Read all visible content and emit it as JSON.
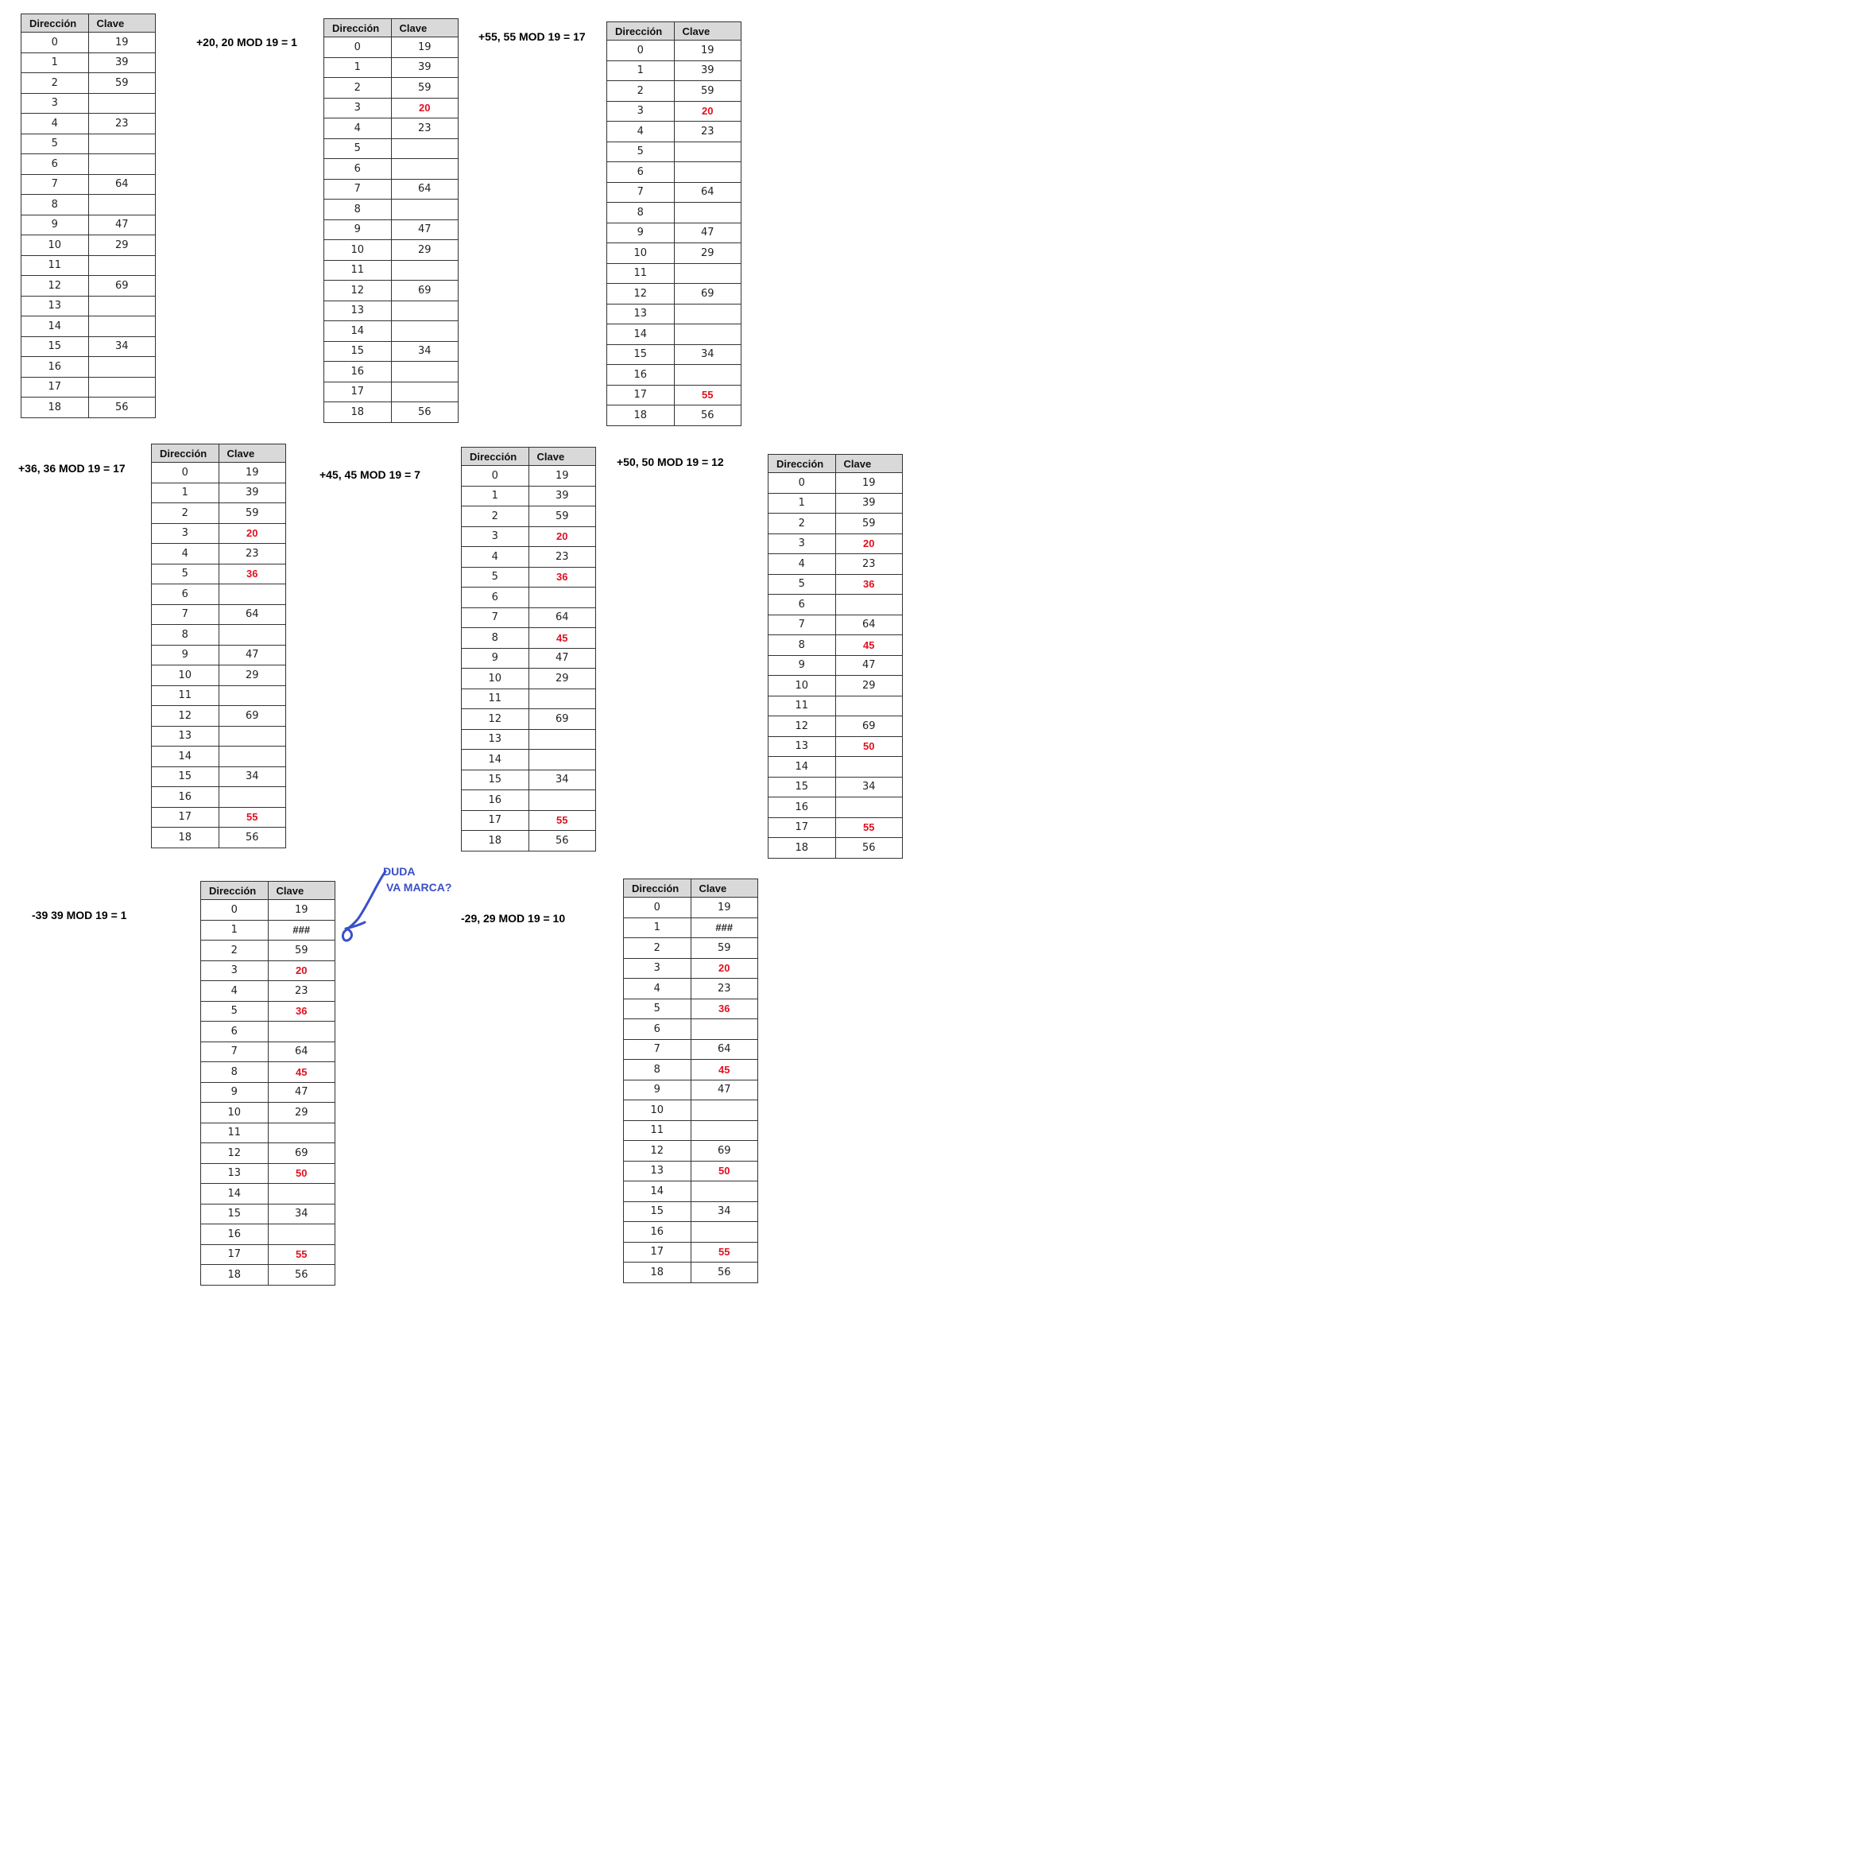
{
  "headers": {
    "address": "Dirección",
    "key": "Clave"
  },
  "steps": [
    {
      "op_label": "",
      "rows": [
        {
          "addr": "0",
          "key": "19"
        },
        {
          "addr": "1",
          "key": "39"
        },
        {
          "addr": "2",
          "key": "59"
        },
        {
          "addr": "3",
          "key": ""
        },
        {
          "addr": "4",
          "key": "23"
        },
        {
          "addr": "5",
          "key": ""
        },
        {
          "addr": "6",
          "key": ""
        },
        {
          "addr": "7",
          "key": "64"
        },
        {
          "addr": "8",
          "key": ""
        },
        {
          "addr": "9",
          "key": "47"
        },
        {
          "addr": "10",
          "key": "29"
        },
        {
          "addr": "11",
          "key": ""
        },
        {
          "addr": "12",
          "key": "69"
        },
        {
          "addr": "13",
          "key": ""
        },
        {
          "addr": "14",
          "key": ""
        },
        {
          "addr": "15",
          "key": "34"
        },
        {
          "addr": "16",
          "key": ""
        },
        {
          "addr": "17",
          "key": ""
        },
        {
          "addr": "18",
          "key": "56"
        }
      ]
    },
    {
      "op_label": "+20, 20 MOD 19 = 1",
      "rows": [
        {
          "addr": "0",
          "key": "19"
        },
        {
          "addr": "1",
          "key": "39"
        },
        {
          "addr": "2",
          "key": "59"
        },
        {
          "addr": "3",
          "key": "20",
          "new": true
        },
        {
          "addr": "4",
          "key": "23"
        },
        {
          "addr": "5",
          "key": ""
        },
        {
          "addr": "6",
          "key": ""
        },
        {
          "addr": "7",
          "key": "64"
        },
        {
          "addr": "8",
          "key": ""
        },
        {
          "addr": "9",
          "key": "47"
        },
        {
          "addr": "10",
          "key": "29"
        },
        {
          "addr": "11",
          "key": ""
        },
        {
          "addr": "12",
          "key": "69"
        },
        {
          "addr": "13",
          "key": ""
        },
        {
          "addr": "14",
          "key": ""
        },
        {
          "addr": "15",
          "key": "34"
        },
        {
          "addr": "16",
          "key": ""
        },
        {
          "addr": "17",
          "key": ""
        },
        {
          "addr": "18",
          "key": "56"
        }
      ]
    },
    {
      "op_label": "+55, 55 MOD 19 = 17",
      "rows": [
        {
          "addr": "0",
          "key": "19"
        },
        {
          "addr": "1",
          "key": "39"
        },
        {
          "addr": "2",
          "key": "59"
        },
        {
          "addr": "3",
          "key": "20",
          "new": true
        },
        {
          "addr": "4",
          "key": "23"
        },
        {
          "addr": "5",
          "key": ""
        },
        {
          "addr": "6",
          "key": ""
        },
        {
          "addr": "7",
          "key": "64"
        },
        {
          "addr": "8",
          "key": ""
        },
        {
          "addr": "9",
          "key": "47"
        },
        {
          "addr": "10",
          "key": "29"
        },
        {
          "addr": "11",
          "key": ""
        },
        {
          "addr": "12",
          "key": "69"
        },
        {
          "addr": "13",
          "key": ""
        },
        {
          "addr": "14",
          "key": ""
        },
        {
          "addr": "15",
          "key": "34"
        },
        {
          "addr": "16",
          "key": ""
        },
        {
          "addr": "17",
          "key": "55",
          "new": true
        },
        {
          "addr": "18",
          "key": "56"
        }
      ]
    },
    {
      "op_label": "+36, 36 MOD 19 = 17",
      "rows": [
        {
          "addr": "0",
          "key": "19"
        },
        {
          "addr": "1",
          "key": "39"
        },
        {
          "addr": "2",
          "key": "59"
        },
        {
          "addr": "3",
          "key": "20",
          "new": true
        },
        {
          "addr": "4",
          "key": "23"
        },
        {
          "addr": "5",
          "key": "36",
          "new": true
        },
        {
          "addr": "6",
          "key": ""
        },
        {
          "addr": "7",
          "key": "64"
        },
        {
          "addr": "8",
          "key": ""
        },
        {
          "addr": "9",
          "key": "47"
        },
        {
          "addr": "10",
          "key": "29"
        },
        {
          "addr": "11",
          "key": ""
        },
        {
          "addr": "12",
          "key": "69"
        },
        {
          "addr": "13",
          "key": ""
        },
        {
          "addr": "14",
          "key": ""
        },
        {
          "addr": "15",
          "key": "34"
        },
        {
          "addr": "16",
          "key": ""
        },
        {
          "addr": "17",
          "key": "55",
          "new": true
        },
        {
          "addr": "18",
          "key": "56"
        }
      ]
    },
    {
      "op_label": "+45, 45 MOD 19 = 7",
      "rows": [
        {
          "addr": "0",
          "key": "19"
        },
        {
          "addr": "1",
          "key": "39"
        },
        {
          "addr": "2",
          "key": "59"
        },
        {
          "addr": "3",
          "key": "20",
          "new": true
        },
        {
          "addr": "4",
          "key": "23"
        },
        {
          "addr": "5",
          "key": "36",
          "new": true
        },
        {
          "addr": "6",
          "key": ""
        },
        {
          "addr": "7",
          "key": "64"
        },
        {
          "addr": "8",
          "key": "45",
          "new": true
        },
        {
          "addr": "9",
          "key": "47"
        },
        {
          "addr": "10",
          "key": "29"
        },
        {
          "addr": "11",
          "key": ""
        },
        {
          "addr": "12",
          "key": "69"
        },
        {
          "addr": "13",
          "key": ""
        },
        {
          "addr": "14",
          "key": ""
        },
        {
          "addr": "15",
          "key": "34"
        },
        {
          "addr": "16",
          "key": ""
        },
        {
          "addr": "17",
          "key": "55",
          "new": true
        },
        {
          "addr": "18",
          "key": "56"
        }
      ]
    },
    {
      "op_label": "+50, 50 MOD 19 = 12",
      "rows": [
        {
          "addr": "0",
          "key": "19"
        },
        {
          "addr": "1",
          "key": "39"
        },
        {
          "addr": "2",
          "key": "59"
        },
        {
          "addr": "3",
          "key": "20",
          "new": true
        },
        {
          "addr": "4",
          "key": "23"
        },
        {
          "addr": "5",
          "key": "36",
          "new": true
        },
        {
          "addr": "6",
          "key": ""
        },
        {
          "addr": "7",
          "key": "64"
        },
        {
          "addr": "8",
          "key": "45",
          "new": true
        },
        {
          "addr": "9",
          "key": "47"
        },
        {
          "addr": "10",
          "key": "29"
        },
        {
          "addr": "11",
          "key": ""
        },
        {
          "addr": "12",
          "key": "69"
        },
        {
          "addr": "13",
          "key": "50",
          "new": true
        },
        {
          "addr": "14",
          "key": ""
        },
        {
          "addr": "15",
          "key": "34"
        },
        {
          "addr": "16",
          "key": ""
        },
        {
          "addr": "17",
          "key": "55",
          "new": true
        },
        {
          "addr": "18",
          "key": "56"
        }
      ]
    },
    {
      "op_label": "-39  39 MOD 19 = 1",
      "rows": [
        {
          "addr": "0",
          "key": "19"
        },
        {
          "addr": "1",
          "key": "###",
          "mark": true
        },
        {
          "addr": "2",
          "key": "59"
        },
        {
          "addr": "3",
          "key": "20",
          "new": true
        },
        {
          "addr": "4",
          "key": "23"
        },
        {
          "addr": "5",
          "key": "36",
          "new": true
        },
        {
          "addr": "6",
          "key": ""
        },
        {
          "addr": "7",
          "key": "64"
        },
        {
          "addr": "8",
          "key": "45",
          "new": true
        },
        {
          "addr": "9",
          "key": "47"
        },
        {
          "addr": "10",
          "key": "29"
        },
        {
          "addr": "11",
          "key": ""
        },
        {
          "addr": "12",
          "key": "69"
        },
        {
          "addr": "13",
          "key": "50",
          "new": true
        },
        {
          "addr": "14",
          "key": ""
        },
        {
          "addr": "15",
          "key": "34"
        },
        {
          "addr": "16",
          "key": ""
        },
        {
          "addr": "17",
          "key": "55",
          "new": true
        },
        {
          "addr": "18",
          "key": "56"
        }
      ]
    },
    {
      "op_label": "-29, 29 MOD 19 = 10",
      "rows": [
        {
          "addr": "0",
          "key": "19"
        },
        {
          "addr": "1",
          "key": "###",
          "mark": true
        },
        {
          "addr": "2",
          "key": "59"
        },
        {
          "addr": "3",
          "key": "20",
          "new": true
        },
        {
          "addr": "4",
          "key": "23"
        },
        {
          "addr": "5",
          "key": "36",
          "new": true
        },
        {
          "addr": "6",
          "key": ""
        },
        {
          "addr": "7",
          "key": "64"
        },
        {
          "addr": "8",
          "key": "45",
          "new": true
        },
        {
          "addr": "9",
          "key": "47"
        },
        {
          "addr": "10",
          "key": ""
        },
        {
          "addr": "11",
          "key": ""
        },
        {
          "addr": "12",
          "key": "69"
        },
        {
          "addr": "13",
          "key": "50",
          "new": true
        },
        {
          "addr": "14",
          "key": ""
        },
        {
          "addr": "15",
          "key": "34"
        },
        {
          "addr": "16",
          "key": ""
        },
        {
          "addr": "17",
          "key": "55",
          "new": true
        },
        {
          "addr": "18",
          "key": "56"
        }
      ]
    }
  ],
  "annotation": {
    "line1": "DUDA",
    "line2": "VA MARCA?",
    "color": "#3a4fc8"
  },
  "colors": {
    "new_key": "#e01020",
    "header_bg": "#d9d9d9"
  }
}
